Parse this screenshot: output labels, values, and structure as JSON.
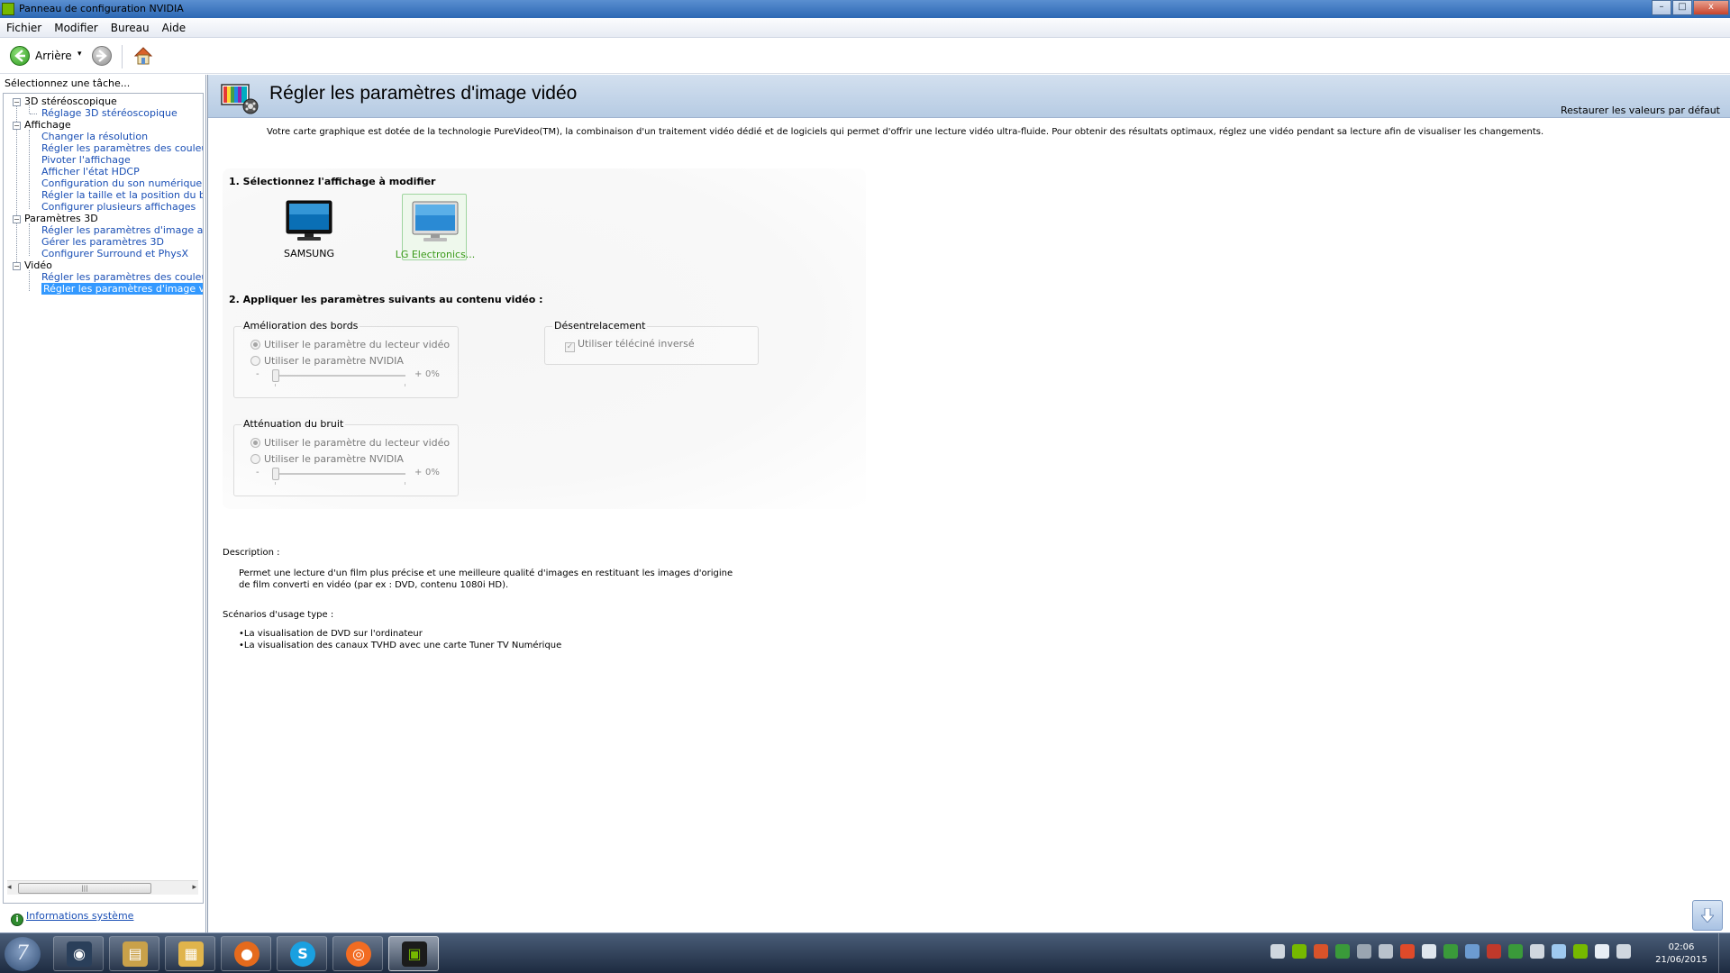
{
  "window": {
    "title": "Panneau de configuration NVIDIA",
    "controls": {
      "minimize": "–",
      "maximize": "□",
      "close": "x"
    }
  },
  "menu": [
    "Fichier",
    "Modifier",
    "Bureau",
    "Aide"
  ],
  "toolbar": {
    "back_label": "Arrière",
    "back_dropdown": "▾"
  },
  "left": {
    "task_header": "Sélectionnez une tâche...",
    "groups": [
      {
        "label": "3D stéréoscopique",
        "expander": "−",
        "items": [
          "Réglage 3D stéréoscopique"
        ]
      },
      {
        "label": "Affichage",
        "expander": "−",
        "items": [
          "Changer la résolution",
          "Régler les paramètres des couleurs d",
          "Pivoter l'affichage",
          "Afficher l'état HDCP",
          "Configuration du son numérique",
          "Régler la taille et la position du burea",
          "Configurer plusieurs affichages"
        ]
      },
      {
        "label": "Paramètres 3D",
        "expander": "−",
        "items": [
          "Régler les paramètres d'image avec A",
          "Gérer les paramètres 3D",
          "Configurer Surround et PhysX"
        ]
      },
      {
        "label": "Vidéo",
        "expander": "−",
        "items": [
          "Régler les paramètres des couleurs v",
          "Régler les paramètres d'image vidéo"
        ]
      }
    ],
    "selected_item": "Régler les paramètres d'image vidéo",
    "scroll": {
      "left": "◂",
      "right": "▸",
      "grip": "|||"
    },
    "system_info": "Informations système"
  },
  "content": {
    "title": "Régler les paramètres d'image vidéo",
    "restore_defaults": "Restaurer les valeurs par défaut",
    "intro": "Votre carte graphique est dotée de la technologie PureVideo(TM), la combinaison d'un traitement vidéo dédié et de logiciels qui permet d'offrir une lecture vidéo ultra-fluide. Pour obtenir des résultats optimaux, réglez une vidéo pendant sa lecture afin de visualiser les changements.",
    "step1_title": "1. Sélectionnez l'affichage à modifier",
    "displays": [
      {
        "name": "SAMSUNG",
        "selected": false
      },
      {
        "name": "LG Electronics...",
        "selected": true
      }
    ],
    "step2_title": "2. Appliquer les paramètres suivants au contenu vidéo :",
    "edge": {
      "title": "Amélioration des bords",
      "option_player": "Utiliser le paramètre du lecteur vidéo",
      "option_nvidia": "Utiliser le paramètre NVIDIA",
      "minus": "-",
      "plus": "+",
      "value": "0%"
    },
    "noise": {
      "title": "Atténuation du bruit",
      "option_player": "Utiliser le paramètre du lecteur vidéo",
      "option_nvidia": "Utiliser le paramètre NVIDIA",
      "minus": "-",
      "plus": "+",
      "value": "0%"
    },
    "deinterlace": {
      "title": "Désentrelacement",
      "option": "Utiliser téléciné inversé",
      "checked": true
    },
    "description_title": "Description :",
    "description": "Permet une lecture d'un film plus précise et une meilleure qualité d'images en restituant les images d'origine de film converti en vidéo (par ex : DVD, contenu 1080i HD).",
    "scenarios_title": "Scénarios d'usage type :",
    "scenarios": [
      "La visualisation de DVD sur l'ordinateur",
      "La visualisation des canaux TVHD avec une carte Tuner TV Numérique"
    ],
    "bullet": "•"
  },
  "taskbar": {
    "start_glyph": "7",
    "apps": [
      {
        "name": "steam",
        "glyph": "◉",
        "color": "#2a3f5a"
      },
      {
        "name": "explorer-libraries",
        "glyph": "▤",
        "color": "#c9a14a"
      },
      {
        "name": "file-explorer",
        "glyph": "▦",
        "color": "#e0b44c"
      },
      {
        "name": "firefox",
        "glyph": "●",
        "color": "#e56a1c"
      },
      {
        "name": "skype",
        "glyph": "S",
        "color": "#1aa0e0"
      },
      {
        "name": "origin",
        "glyph": "◎",
        "color": "#f26c22"
      },
      {
        "name": "nvidia",
        "glyph": "▣",
        "color": "#76b900"
      }
    ],
    "tray_colors": [
      "#cfd6de",
      "#76b900",
      "#d9532a",
      "#3a9a3a",
      "#9aa5b1",
      "#b9c2cc",
      "#e04a2a",
      "#dfe6ee",
      "#3a9a3a",
      "#6c9bd1",
      "#c0392b",
      "#3a9a3a",
      "#d0d7df",
      "#9ec9f0",
      "#76b900",
      "#e8eef5",
      "#d0d7df"
    ],
    "time": "02:06",
    "date": "21/06/2015"
  }
}
